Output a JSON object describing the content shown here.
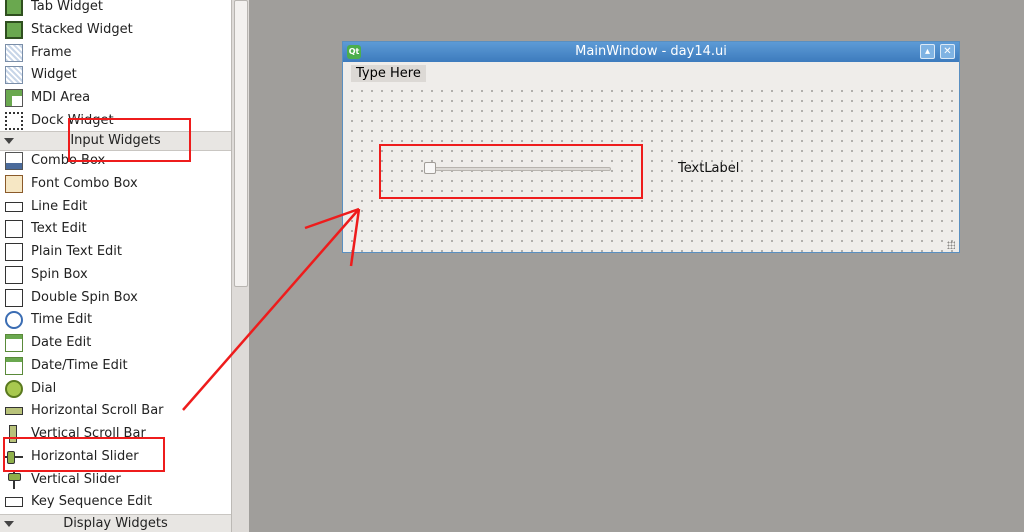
{
  "widget_box": {
    "items_top": [
      {
        "label": "Tab Widget",
        "icon": "tab-widget-icon"
      },
      {
        "label": "Stacked Widget",
        "icon": "stacked-widget-icon"
      },
      {
        "label": "Frame",
        "icon": "frame-icon"
      },
      {
        "label": "Widget",
        "icon": "widget-icon"
      },
      {
        "label": "MDI Area",
        "icon": "mdi-area-icon"
      },
      {
        "label": "Dock Widget",
        "icon": "dock-widget-icon"
      }
    ],
    "category_input": "Input Widgets",
    "items_input": [
      {
        "label": "Combo Box",
        "icon": "combo-box-icon"
      },
      {
        "label": "Font Combo Box",
        "icon": "font-combo-box-icon"
      },
      {
        "label": "Line Edit",
        "icon": "line-edit-icon"
      },
      {
        "label": "Text Edit",
        "icon": "text-edit-icon"
      },
      {
        "label": "Plain Text Edit",
        "icon": "plain-text-edit-icon"
      },
      {
        "label": "Spin Box",
        "icon": "spin-box-icon"
      },
      {
        "label": "Double Spin Box",
        "icon": "double-spin-box-icon"
      },
      {
        "label": "Time Edit",
        "icon": "time-edit-icon"
      },
      {
        "label": "Date Edit",
        "icon": "date-edit-icon"
      },
      {
        "label": "Date/Time Edit",
        "icon": "date-time-edit-icon"
      },
      {
        "label": "Dial",
        "icon": "dial-icon"
      },
      {
        "label": "Horizontal Scroll Bar",
        "icon": "horizontal-scroll-bar-icon"
      },
      {
        "label": "Vertical Scroll Bar",
        "icon": "vertical-scroll-bar-icon"
      },
      {
        "label": "Horizontal Slider",
        "icon": "horizontal-slider-icon"
      },
      {
        "label": "Vertical Slider",
        "icon": "vertical-slider-icon"
      },
      {
        "label": "Key Sequence Edit",
        "icon": "key-sequence-edit-icon"
      }
    ],
    "category_display": "Display Widgets"
  },
  "main_window": {
    "title": "MainWindow - day14.ui",
    "logo_text": "Qt",
    "menu_placeholder": "Type Here",
    "text_label": "TextLabel",
    "slider_value": 0
  },
  "colors": {
    "annotation": "#ee1c1c",
    "titlebar": "#4a88c8",
    "canvas_bg": "#a09e9b"
  }
}
